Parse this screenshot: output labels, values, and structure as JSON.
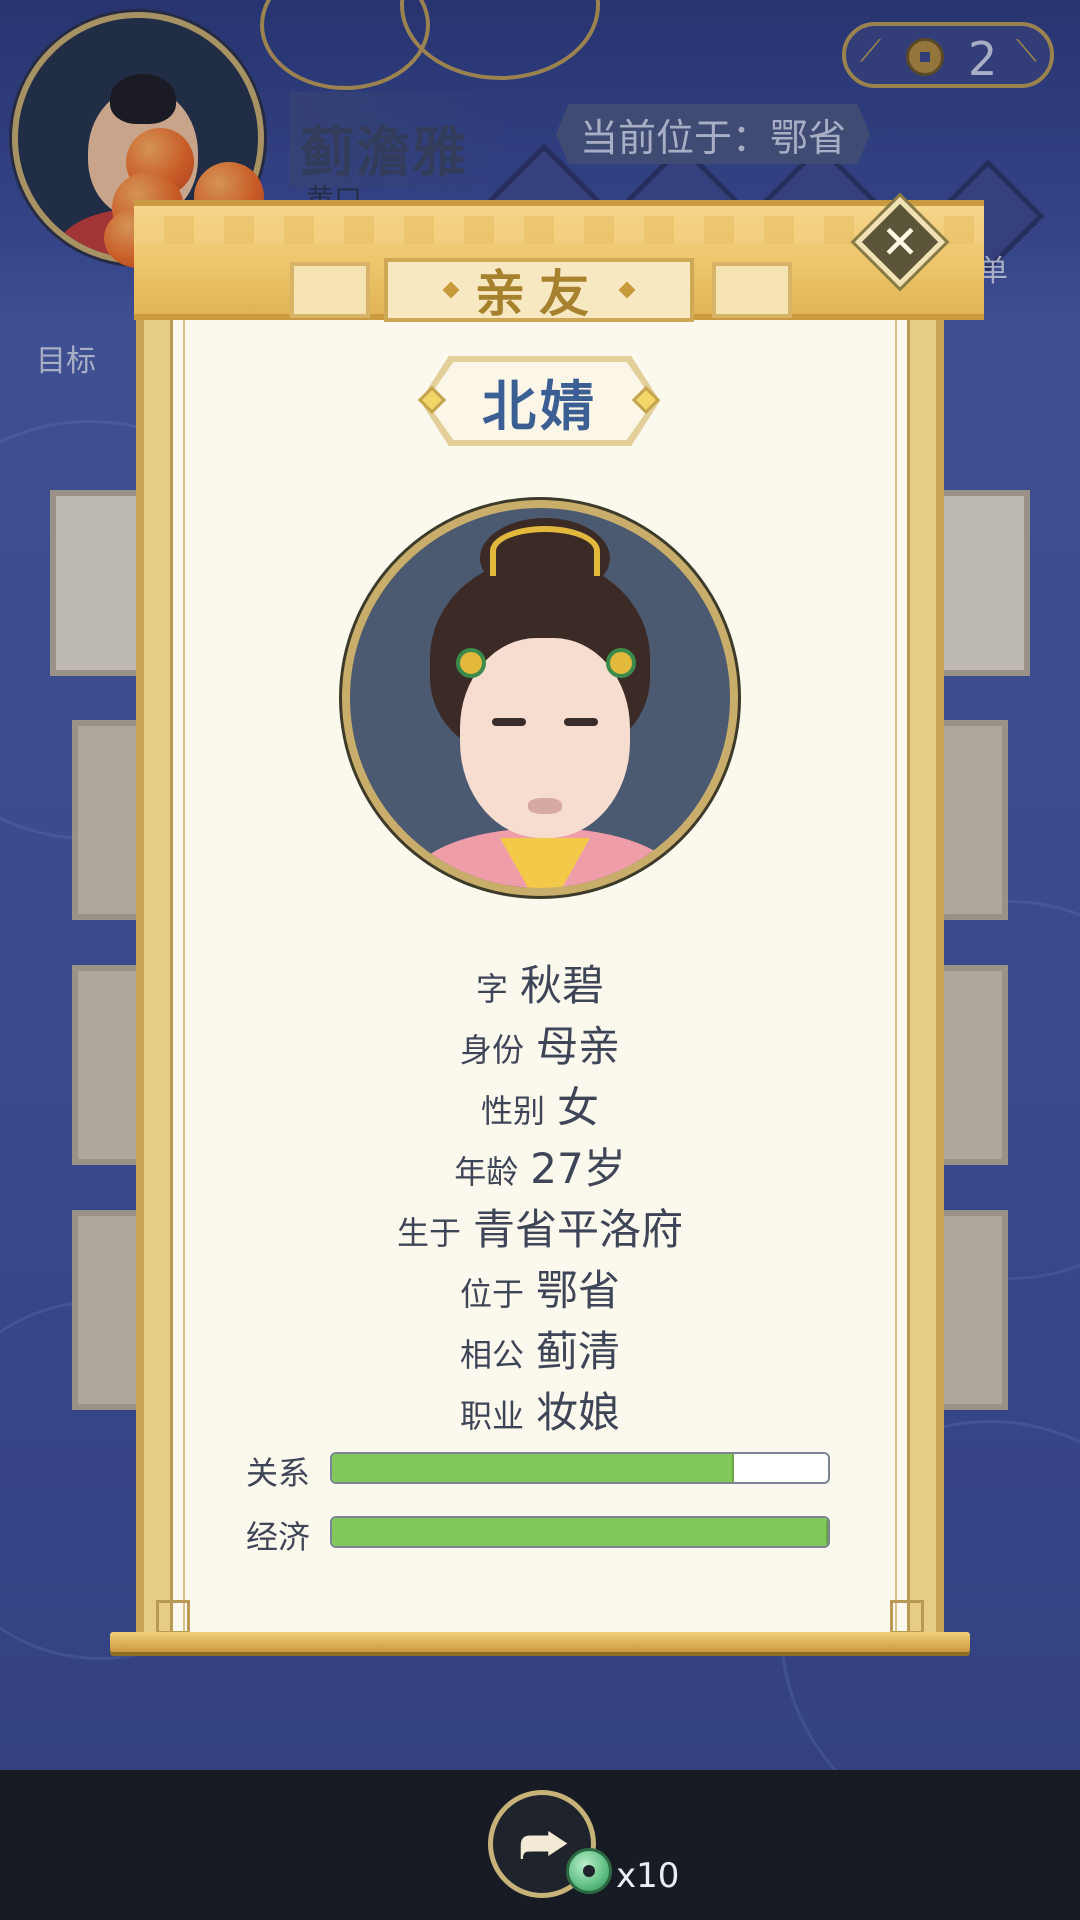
{
  "header": {
    "player_name": "蓟澹雅",
    "player_subtitle": "黄口",
    "location_label": "当前位于：鄂省",
    "coin_count": "2",
    "menu_label": "菜单",
    "goal_label": "目标"
  },
  "modal": {
    "title": "亲友",
    "close_symbol": "✕",
    "character": {
      "name": "北婧",
      "fields": [
        {
          "label": "字",
          "value": "秋碧"
        },
        {
          "label": "身份",
          "value": "母亲"
        },
        {
          "label": "性别",
          "value": "女"
        },
        {
          "label": "年龄",
          "value": "27岁"
        },
        {
          "label": "生于",
          "value": "青省平洛府"
        },
        {
          "label": "位于",
          "value": "鄂省"
        },
        {
          "label": "相公",
          "value": "蓟清"
        },
        {
          "label": "职业",
          "value": "妆娘"
        }
      ],
      "bars": [
        {
          "label": "关系",
          "value": 0.81
        },
        {
          "label": "经济",
          "value": 1.0
        }
      ]
    }
  },
  "bottom": {
    "share_icon": "share-icon",
    "reward_icon": "jade-coin-icon",
    "reward_count": "x10"
  },
  "colors": {
    "accent_gold": "#c99a3f",
    "name_blue": "#3c5f93",
    "bar_green": "#80c85a"
  }
}
